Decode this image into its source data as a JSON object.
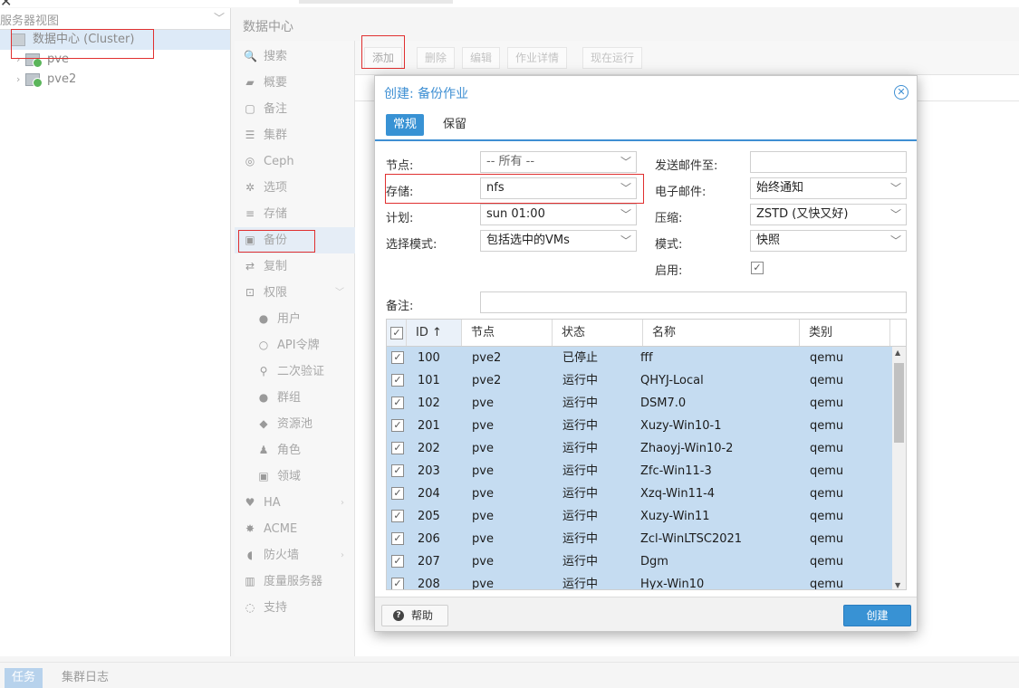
{
  "tree": {
    "view_select": "服务器视图",
    "datacenter_label": "数据中心 (Cluster)",
    "nodes": [
      "pve",
      "pve2"
    ]
  },
  "center": {
    "title": "数据中心",
    "nav": [
      {
        "icon": "search-icon",
        "glyph": "🔍",
        "label": "搜索"
      },
      {
        "icon": "book-icon",
        "glyph": "▰",
        "label": "概要"
      },
      {
        "icon": "note-icon",
        "glyph": "▢",
        "label": "备注"
      },
      {
        "icon": "cluster-icon",
        "glyph": "☰",
        "label": "集群"
      },
      {
        "icon": "ceph-icon",
        "glyph": "◎",
        "label": "Ceph"
      },
      {
        "icon": "gear-icon",
        "glyph": "✲",
        "label": "选项"
      },
      {
        "icon": "database-icon",
        "glyph": "≡",
        "label": "存储"
      },
      {
        "icon": "floppy-icon",
        "glyph": "▣",
        "label": "备份"
      },
      {
        "icon": "retweet-icon",
        "glyph": "⇄",
        "label": "复制"
      },
      {
        "icon": "unlock-icon",
        "glyph": "⊡",
        "label": "权限"
      },
      {
        "icon": "user-icon",
        "glyph": "●",
        "label": "用户"
      },
      {
        "icon": "user-o-icon",
        "glyph": "○",
        "label": "API令牌"
      },
      {
        "icon": "key-icon",
        "glyph": "⚲",
        "label": "二次验证"
      },
      {
        "icon": "users-icon",
        "glyph": "●",
        "label": "群组"
      },
      {
        "icon": "tags-icon",
        "glyph": "◆",
        "label": "资源池"
      },
      {
        "icon": "male-icon",
        "glyph": "♟",
        "label": "角色"
      },
      {
        "icon": "address-book-icon",
        "glyph": "▣",
        "label": "领域"
      },
      {
        "icon": "heartbeat-icon",
        "glyph": "♥",
        "label": "HA"
      },
      {
        "icon": "certificate-icon",
        "glyph": "✸",
        "label": "ACME"
      },
      {
        "icon": "shield-icon",
        "glyph": "◖",
        "label": "防火墙"
      },
      {
        "icon": "bar-chart-icon",
        "glyph": "▥",
        "label": "度量服务器"
      },
      {
        "icon": "comments-icon",
        "glyph": "◌",
        "label": "支持"
      }
    ],
    "toolbar": {
      "add": "添加",
      "delete": "删除",
      "edit": "编辑",
      "job_detail": "作业详情",
      "run_now": "现在运行"
    }
  },
  "bottom": {
    "tasks": "任务",
    "cluster_log": "集群日志"
  },
  "dialog": {
    "title": "创建: 备份作业",
    "close_glyph": "✕",
    "tabs": {
      "general": "常规",
      "retention": "保留"
    },
    "form": {
      "node_label": "节点:",
      "node_value": "-- 所有 --",
      "storage_label": "存储:",
      "storage_value": "nfs",
      "schedule_label": "计划:",
      "schedule_value": "sun 01:00",
      "selmode_label": "选择模式:",
      "selmode_value": "包括选中的VMs",
      "mailto_label": "发送邮件至:",
      "mailto_value": "",
      "email_label": "电子邮件:",
      "email_value": "始终通知",
      "compress_label": "压缩:",
      "compress_value": "ZSTD (又快又好)",
      "mode_label": "模式:",
      "mode_value": "快照",
      "enable_label": "启用:",
      "comment_label": "备注:",
      "comment_value": ""
    },
    "grid": {
      "columns": {
        "id": "ID ↑",
        "node": "节点",
        "status": "状态",
        "name": "名称",
        "type": "类别"
      },
      "rows": [
        {
          "id": "100",
          "node": "pve2",
          "status": "已停止",
          "name": "fff",
          "type": "qemu"
        },
        {
          "id": "101",
          "node": "pve2",
          "status": "运行中",
          "name": "QHYJ-Local",
          "type": "qemu"
        },
        {
          "id": "102",
          "node": "pve",
          "status": "运行中",
          "name": "DSM7.0",
          "type": "qemu"
        },
        {
          "id": "201",
          "node": "pve",
          "status": "运行中",
          "name": "Xuzy-Win10-1",
          "type": "qemu"
        },
        {
          "id": "202",
          "node": "pve",
          "status": "运行中",
          "name": "Zhaoyj-Win10-2",
          "type": "qemu"
        },
        {
          "id": "203",
          "node": "pve",
          "status": "运行中",
          "name": "Zfc-Win11-3",
          "type": "qemu"
        },
        {
          "id": "204",
          "node": "pve",
          "status": "运行中",
          "name": "Xzq-Win11-4",
          "type": "qemu"
        },
        {
          "id": "205",
          "node": "pve",
          "status": "运行中",
          "name": "Xuzy-Win11",
          "type": "qemu"
        },
        {
          "id": "206",
          "node": "pve",
          "status": "运行中",
          "name": "Zcl-WinLTSC2021",
          "type": "qemu"
        },
        {
          "id": "207",
          "node": "pve",
          "status": "运行中",
          "name": "Dgm",
          "type": "qemu"
        },
        {
          "id": "208",
          "node": "pve",
          "status": "运行中",
          "name": "Hyx-Win10",
          "type": "qemu"
        }
      ]
    },
    "footer": {
      "help": "帮助",
      "create": "创建"
    }
  },
  "colors": {
    "accent": "#3892d4",
    "selection": "#c5dcf1",
    "highlight_box": "#e03030"
  }
}
